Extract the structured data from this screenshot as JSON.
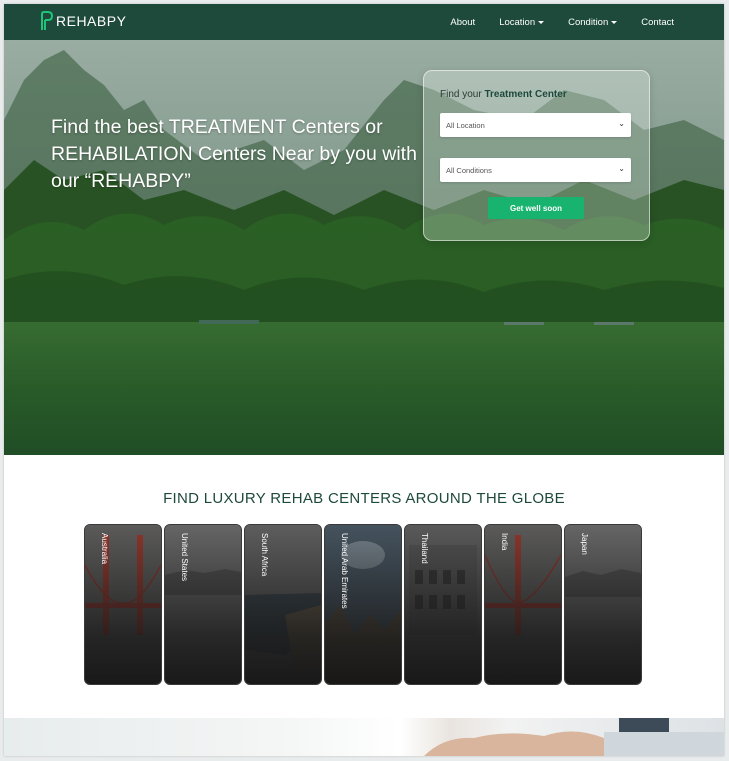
{
  "brand": {
    "name": "REHABPY",
    "accent": "#1e4a3c",
    "button_color": "#18b36f"
  },
  "nav": {
    "links": [
      {
        "label": "About",
        "has_dropdown": false
      },
      {
        "label": "Location",
        "has_dropdown": true
      },
      {
        "label": "Condition",
        "has_dropdown": true
      },
      {
        "label": "Contact",
        "has_dropdown": false
      }
    ]
  },
  "hero": {
    "heading": "Find the best TREATMENT Centers or REHABILATION Centers Near by you with our “REHABPY”"
  },
  "search": {
    "title_prefix": "Find your",
    "title_highlight": "Treatment Center",
    "location_value": "All Location",
    "condition_value": "All Conditions",
    "submit_label": "Get well soon"
  },
  "globe": {
    "title": "FIND LUXURY REHAB CENTERS AROUND THE GLOBE",
    "countries": [
      {
        "name": "Australia",
        "icon": "bridge-image"
      },
      {
        "name": "United States",
        "icon": "cliff-image"
      },
      {
        "name": "South Africa",
        "icon": "coast-image"
      },
      {
        "name": "United Arab Emirates",
        "icon": "rocks-image"
      },
      {
        "name": "Thailand",
        "icon": "colosseum-image"
      },
      {
        "name": "India",
        "icon": "bridge-image"
      },
      {
        "name": "Japan",
        "icon": "cliff-image"
      }
    ]
  }
}
